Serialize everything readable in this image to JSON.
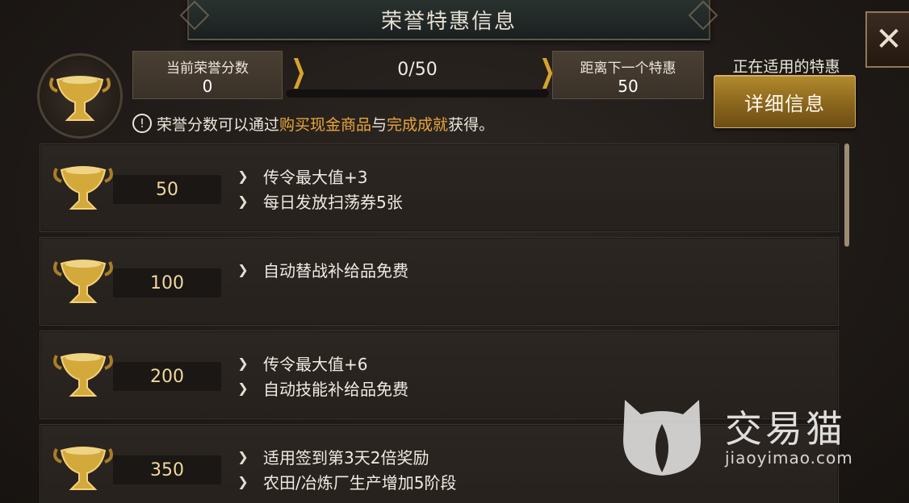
{
  "header": {
    "title": "荣誉特惠信息"
  },
  "status": {
    "current_label": "当前荣誉分数",
    "current_value": "0",
    "progress_text": "0/50",
    "progress_fraction": 0.0,
    "next_label": "距离下一个特惠",
    "next_value": "50"
  },
  "notice": {
    "prefix": "荣誉分数可以通过",
    "link1": "购买现金商品",
    "middle": "与",
    "link2": "完成成就",
    "suffix": "获得。"
  },
  "active_perk": {
    "label": "正在适用的特惠",
    "button_label": "详细信息"
  },
  "tiers": [
    {
      "score": "50",
      "perks": [
        "传令最大值+3",
        "每日发放扫荡券5张"
      ]
    },
    {
      "score": "100",
      "perks": [
        "自动替战补给品免费"
      ]
    },
    {
      "score": "200",
      "perks": [
        "传令最大值+6",
        "自动技能补给品免费"
      ]
    },
    {
      "score": "350",
      "perks": [
        "适用签到第3天2倍奖励",
        "农田/冶炼厂生产增加5阶段"
      ]
    }
  ],
  "watermark": {
    "brand": "交易猫",
    "url": "jiaoyimao.com"
  },
  "colors": {
    "accent_gold": "#d7a32e",
    "highlight": "#e8a63a",
    "score_text": "#f1d79c"
  },
  "icons": {
    "close": "close-icon",
    "trophy": "trophy-icon",
    "info": "info-icon",
    "chevron": "chevron-right-icon"
  }
}
